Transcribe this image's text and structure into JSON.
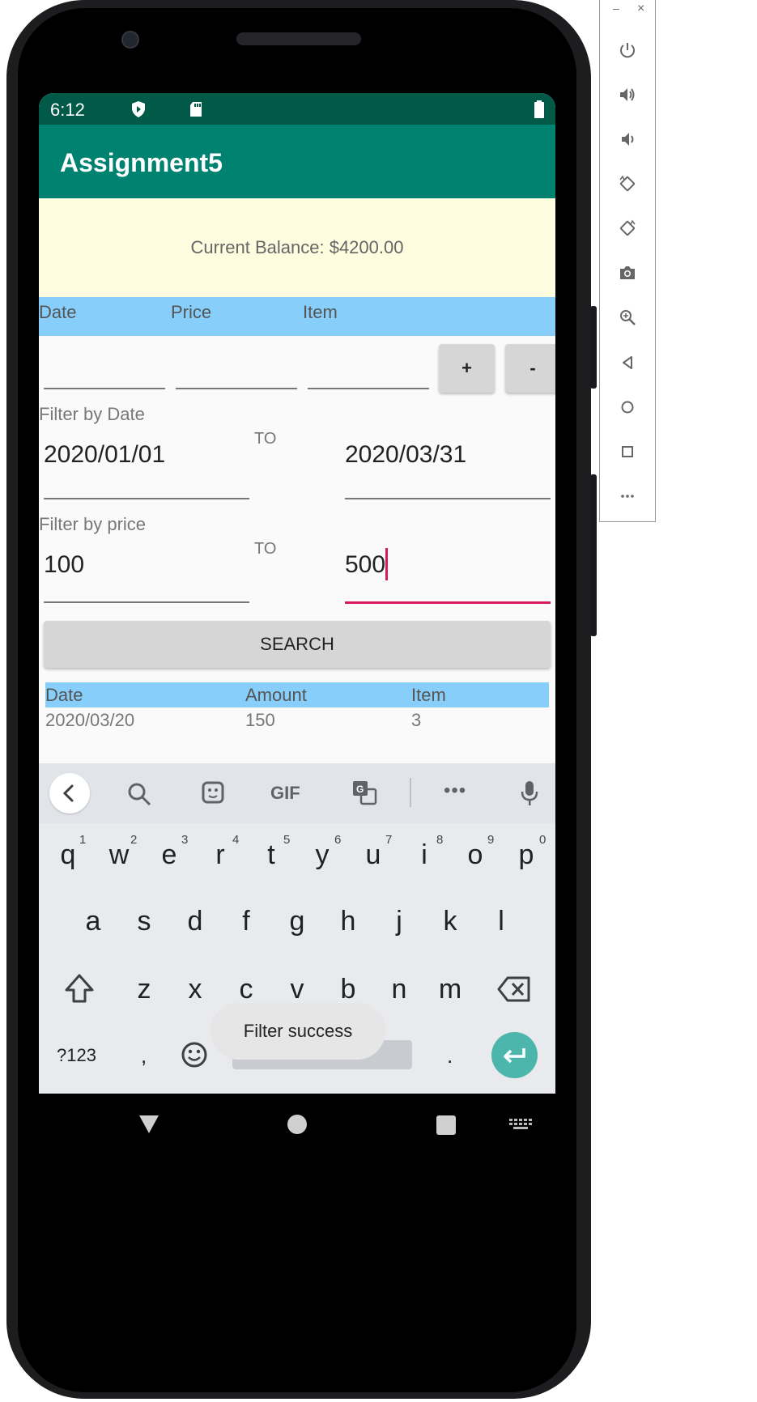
{
  "status_bar": {
    "time": "6:12"
  },
  "app_bar": {
    "title": "Assignment5"
  },
  "balance": {
    "text": "Current Balance: $4200.00"
  },
  "entry_header": {
    "date": "Date",
    "price": "Price",
    "item": "Item"
  },
  "entry_buttons": {
    "add": "+",
    "remove": "-"
  },
  "date_filter": {
    "label": "Filter by Date",
    "from": "2020/01/01",
    "to_label": "TO",
    "to": "2020/03/31"
  },
  "price_filter": {
    "label": "Filter by price",
    "from": "100",
    "to_label": "TO",
    "to": "500"
  },
  "search_button": "SEARCH",
  "results": {
    "columns": [
      "Date",
      "Amount",
      "Item"
    ],
    "rows": [
      {
        "date": "2020/03/20",
        "amount": "150",
        "item": "3"
      }
    ]
  },
  "keyboard": {
    "toolbar_icons": [
      "back-chevron-icon",
      "search-icon",
      "sticker-icon",
      "gif-icon",
      "translate-icon",
      "more-icon",
      "mic-icon"
    ],
    "gif_label": "GIF",
    "more_label": "•••",
    "row1": [
      "q",
      "w",
      "e",
      "r",
      "t",
      "y",
      "u",
      "i",
      "o",
      "p"
    ],
    "row1_digits": [
      "1",
      "2",
      "3",
      "4",
      "5",
      "6",
      "7",
      "8",
      "9",
      "0"
    ],
    "row2": [
      "a",
      "s",
      "d",
      "f",
      "g",
      "h",
      "j",
      "k",
      "l"
    ],
    "row3": [
      "z",
      "x",
      "c",
      "v",
      "b",
      "n",
      "m"
    ],
    "symbols_key": "?123",
    "comma_key": ",",
    "period_key": "."
  },
  "toast": "Filter success",
  "colors": {
    "status_bar": "#005a47",
    "app_bar": "#008271",
    "balance_bg": "#fefde0",
    "header_bg": "#87cefa",
    "focus_accent": "#d81b60",
    "enter_key": "#4db6ac"
  },
  "emulator_panel": {
    "window_controls": [
      "–",
      "×"
    ],
    "icons": [
      "power-icon",
      "volume-up-icon",
      "volume-down-icon",
      "rotate-left-icon",
      "rotate-right-icon",
      "camera-icon",
      "zoom-icon",
      "back-icon",
      "home-icon",
      "overview-icon",
      "more-icon"
    ]
  }
}
